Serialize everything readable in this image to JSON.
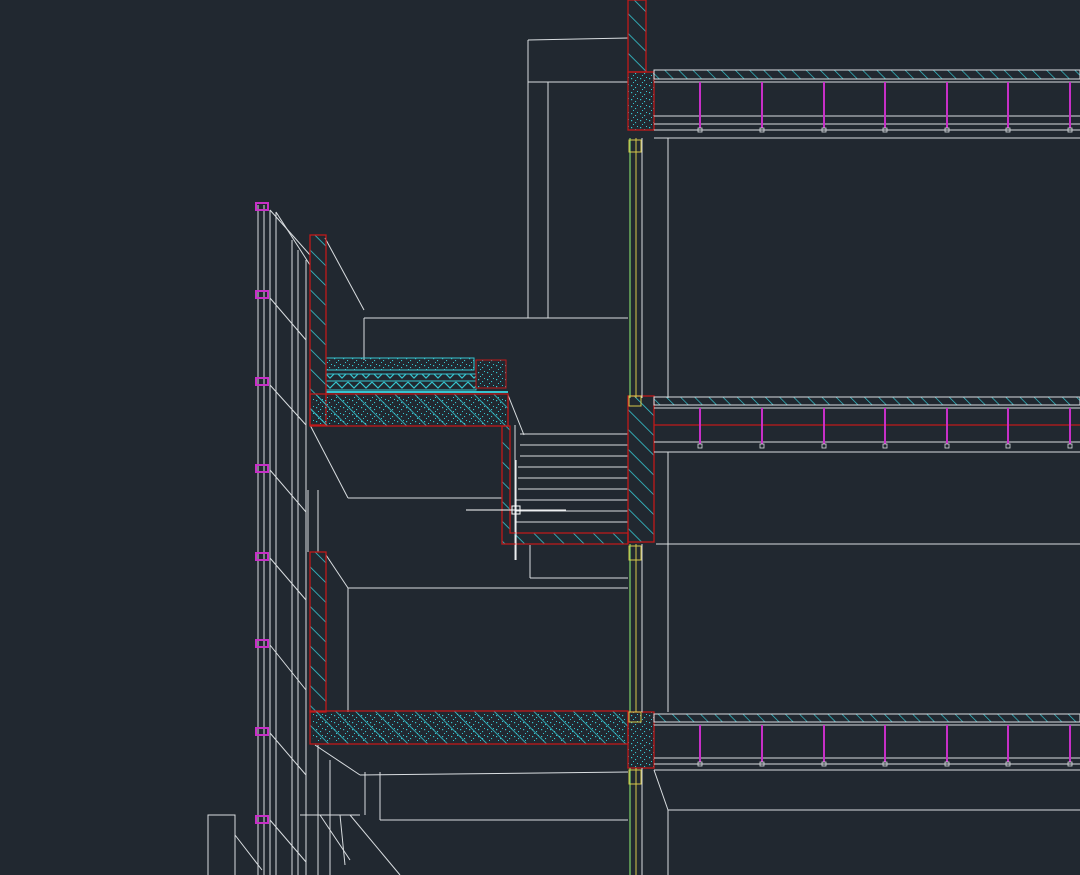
{
  "view": {
    "background": "#212830",
    "content": "cad-section-drawing"
  },
  "colors": {
    "line": "#d9dde0",
    "section_outline": "#c01a1a",
    "hatch": "#36c4cf",
    "rebar": "#c72fc7",
    "glazing_green": "#7fd46a",
    "glazing_yellow": "#d6c84a",
    "crosshair": "#ffffff"
  },
  "cursor": {
    "type": "crosshair"
  }
}
